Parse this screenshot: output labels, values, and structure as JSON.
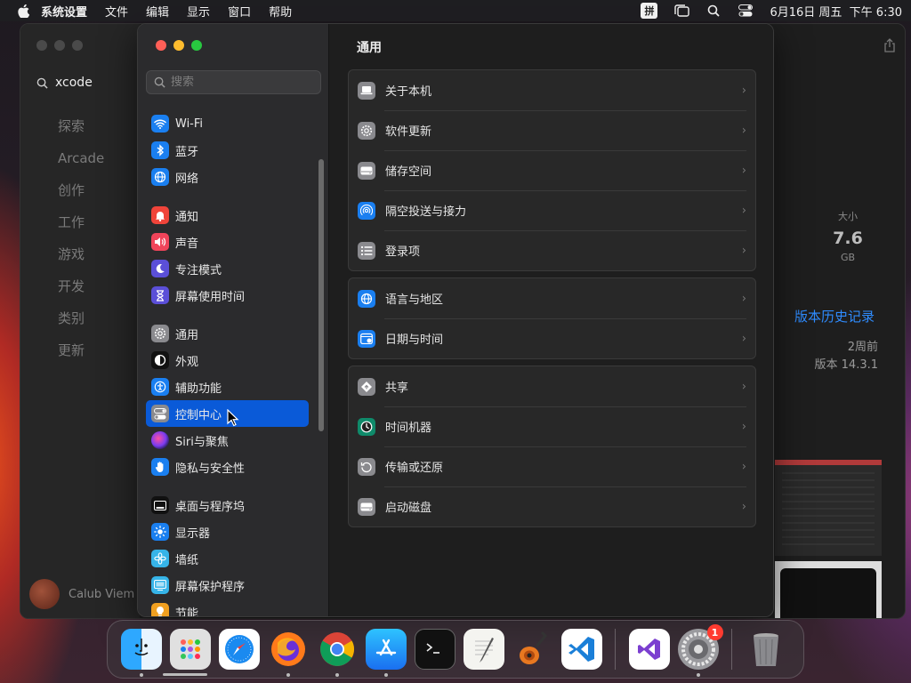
{
  "menubar": {
    "app_name": "系统设置",
    "items": [
      "文件",
      "编辑",
      "显示",
      "窗口",
      "帮助"
    ],
    "ime": "拼",
    "datetime": "6月16日 周五  下午 6:30"
  },
  "app_store": {
    "search_query": "xcode",
    "nav": [
      "探索",
      "Arcade",
      "创作",
      "工作",
      "游戏",
      "开发",
      "类别",
      "更新"
    ],
    "user_name": "Calub Viem",
    "size_label": "大小",
    "size_value": "7.6",
    "size_unit": "GB",
    "version_history": "版本历史记录",
    "updated_ago": "2周前",
    "version": "版本 14.3.1"
  },
  "settings": {
    "search_placeholder": "搜索",
    "sidebar": {
      "g1": [
        "Wi-Fi",
        "蓝牙",
        "网络"
      ],
      "g2": [
        "通知",
        "声音",
        "专注模式",
        "屏幕使用时间"
      ],
      "g3": [
        "通用",
        "外观",
        "辅助功能",
        "控制中心",
        "Siri与聚焦",
        "隐私与安全性"
      ],
      "g4": [
        "桌面与程序坞",
        "显示器",
        "墙纸",
        "屏幕保护程序",
        "节能"
      ]
    },
    "title": "通用",
    "groups": [
      [
        "关于本机",
        "软件更新",
        "储存空间",
        "隔空投送与接力",
        "登录项"
      ],
      [
        "语言与地区",
        "日期与时间"
      ],
      [
        "共享",
        "时间机器",
        "传输或还原",
        "启动磁盘"
      ]
    ]
  },
  "dock": {
    "settings_badge": "1"
  },
  "colors": {
    "accent": "#0a5ad8",
    "link": "#2f8cff"
  }
}
